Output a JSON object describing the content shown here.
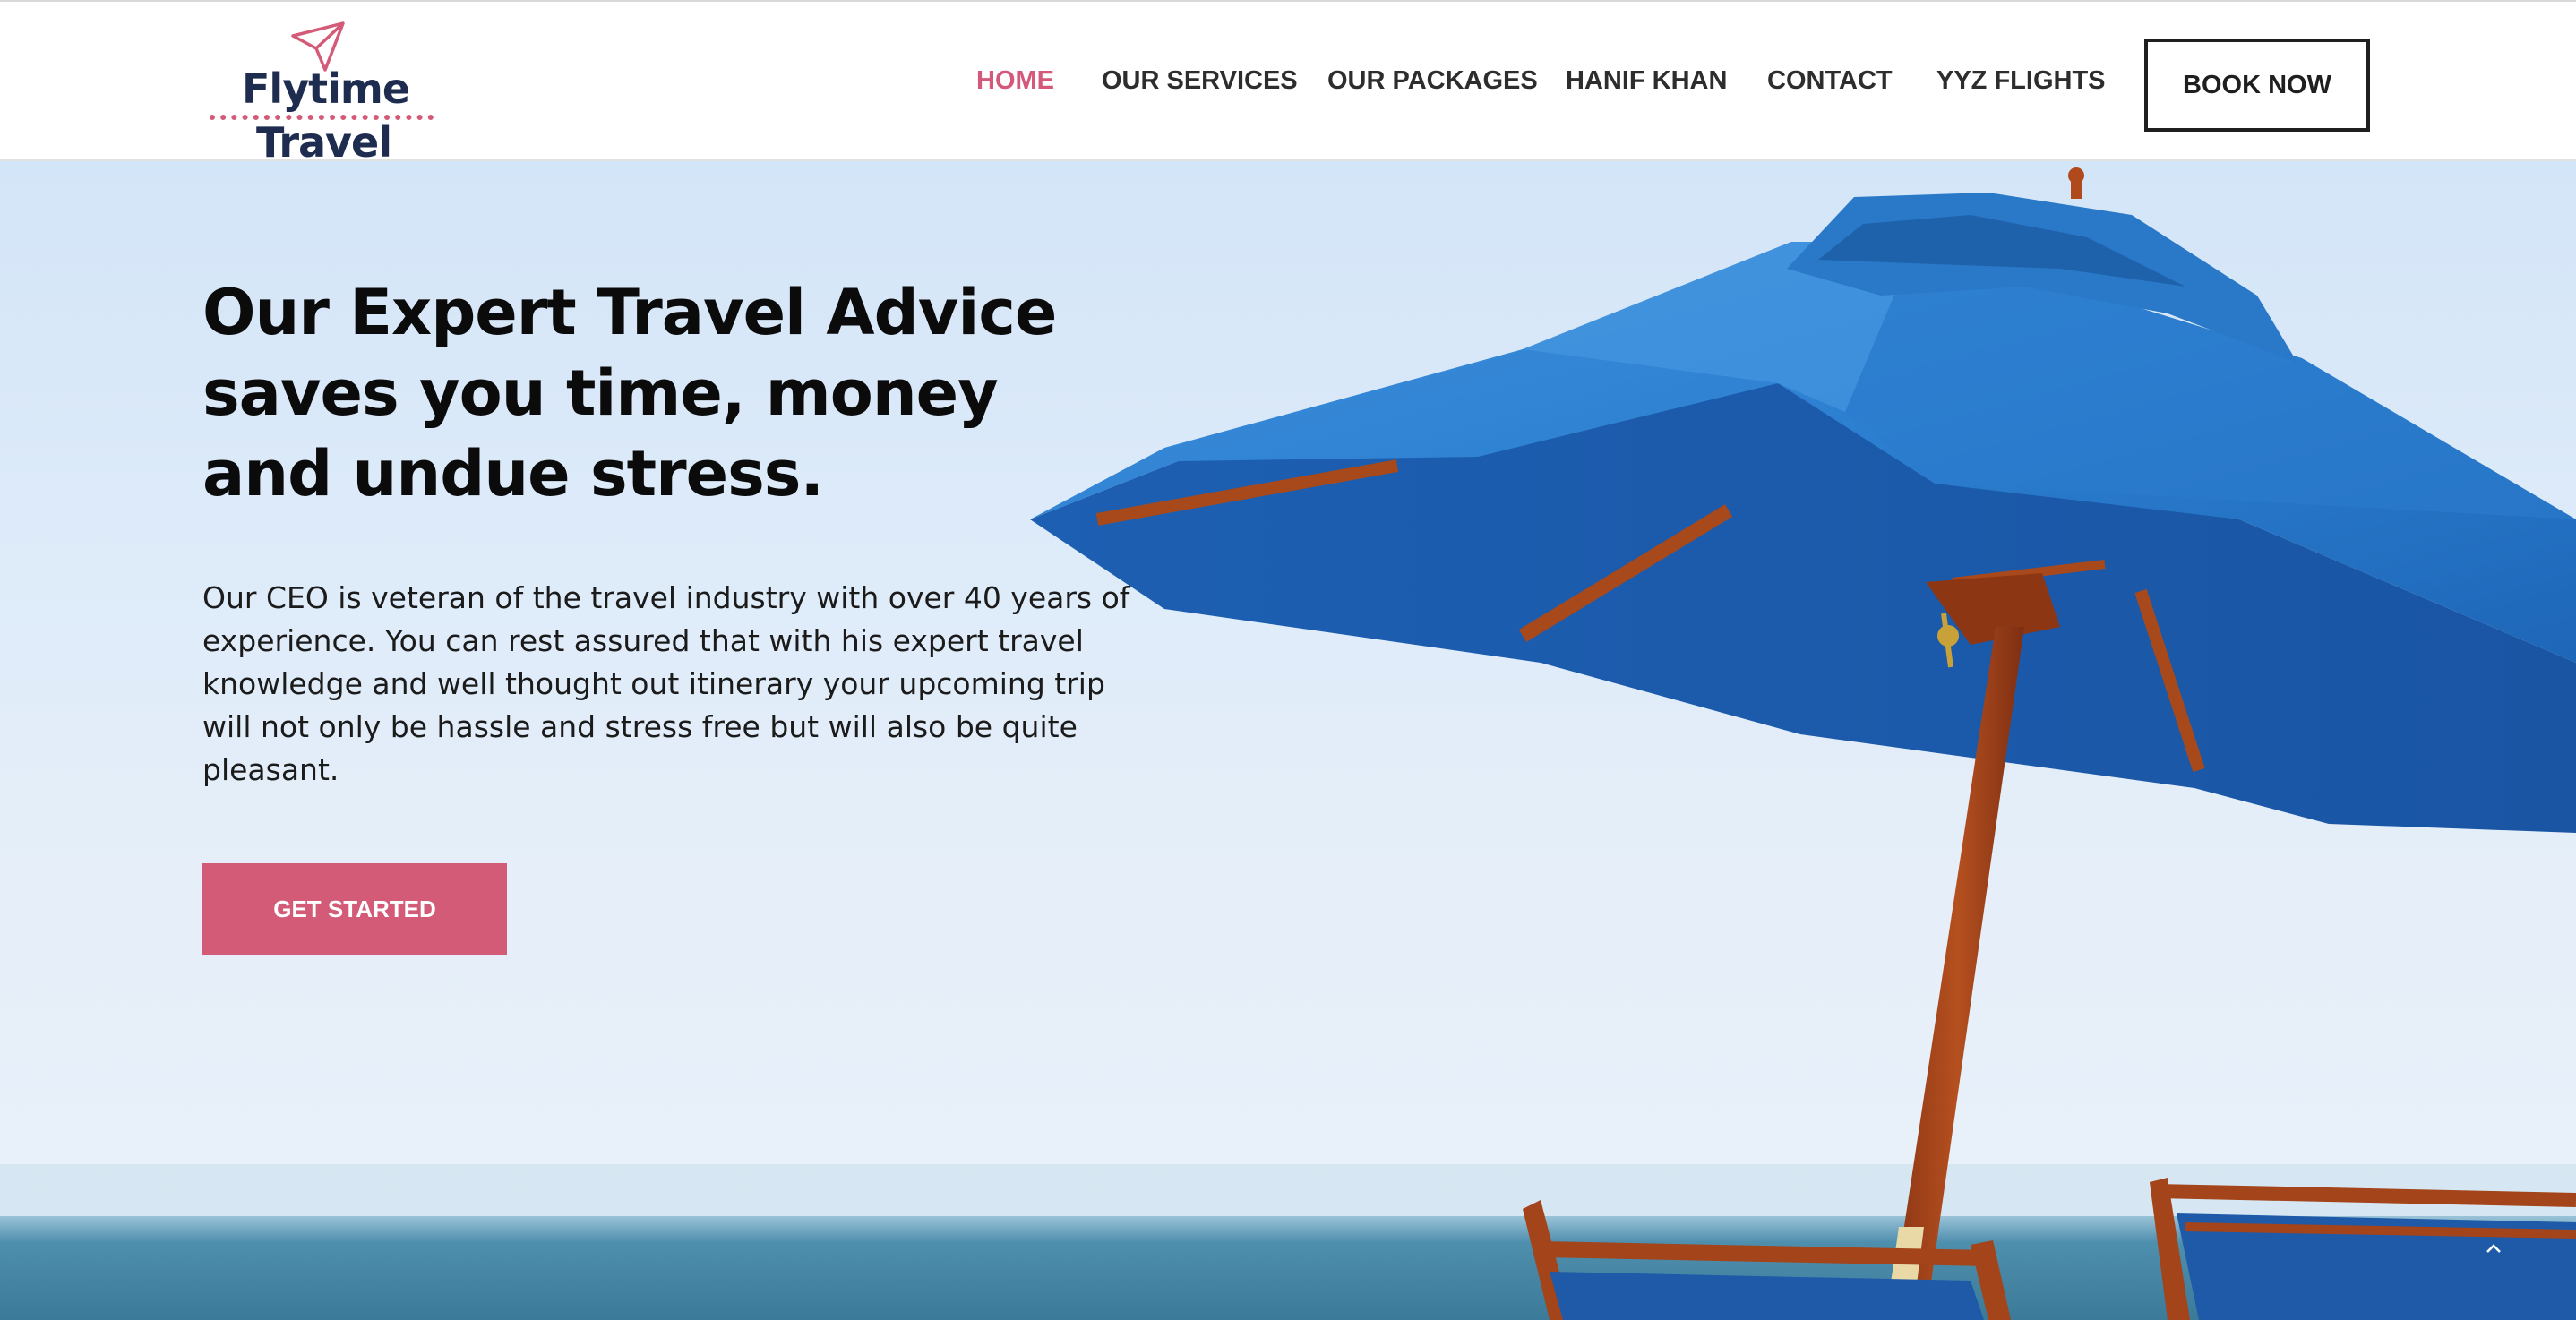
{
  "brand": {
    "logo_line1": "Flytime",
    "logo_line2": "Travel",
    "accent_color": "#d4587a",
    "navy_color": "#1e2d4f"
  },
  "nav": {
    "items": [
      {
        "label": "HOME",
        "active": true
      },
      {
        "label": "OUR SERVICES",
        "active": false
      },
      {
        "label": "OUR PACKAGES",
        "active": false
      },
      {
        "label": "HANIF KHAN",
        "active": false
      },
      {
        "label": "CONTACT",
        "active": false
      },
      {
        "label": "YYZ FLIGHTS",
        "active": false
      }
    ],
    "book_now": "BOOK NOW"
  },
  "hero": {
    "headline_lines": [
      "Our Expert Travel Advice",
      "saves you time, money",
      "and undue stress."
    ],
    "body_lines": [
      "Our CEO is veteran of the travel industry with over 40 years of",
      "experience. You can rest assured that with his expert travel",
      "knowledge and well thought out itinerary your upcoming trip",
      "will not only be hassle and stress free but will also be quite",
      "pleasant."
    ],
    "cta_label": "GET STARTED",
    "image_subject": "blue beach umbrella with wooden deck chairs by the sea"
  },
  "icons": {
    "logo": "paper-plane-icon",
    "scroll_top": "chevron-up-icon"
  }
}
